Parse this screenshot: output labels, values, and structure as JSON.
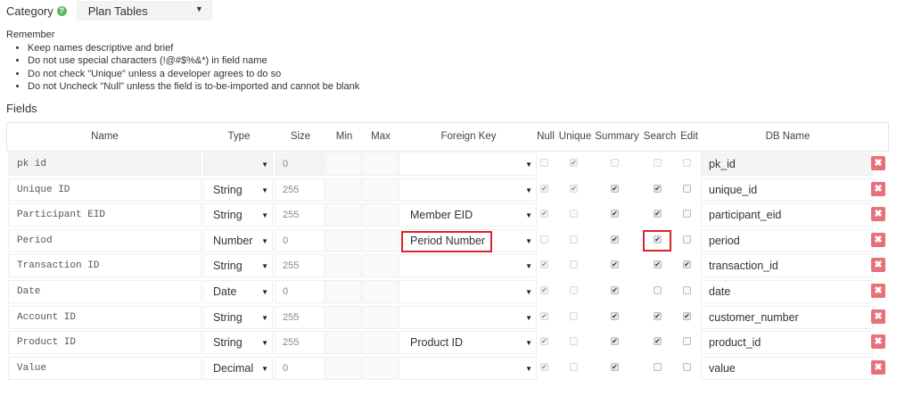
{
  "category": {
    "label": "Category",
    "help_icon": "question-icon",
    "selected": "Plan Tables"
  },
  "remember": {
    "title": "Remember",
    "items": [
      "Keep names descriptive and brief",
      "Do not use special characters (!@#$%&*) in field name",
      "Do not check \"Unique\" unless a developer agrees to do so",
      "Do not Uncheck \"Null\" unless the field is to-be-imported and cannot be blank"
    ]
  },
  "fields_title": "Fields",
  "columns": {
    "name": "Name",
    "type": "Type",
    "size": "Size",
    "min": "Min",
    "max": "Max",
    "fk": "Foreign Key",
    "null": "Null",
    "unique": "Unique",
    "summary": "Summary",
    "search": "Search",
    "edit": "Edit",
    "db": "DB Name"
  },
  "rows": [
    {
      "name": "pk id",
      "type": "",
      "size": "0",
      "fk": "",
      "null": false,
      "unique": true,
      "summary": false,
      "search": false,
      "edit": false,
      "db": "pk_id",
      "grey": true
    },
    {
      "name": "Unique ID",
      "type": "String",
      "size": "255",
      "fk": "",
      "null": true,
      "unique": true,
      "summary": true,
      "search": true,
      "edit": false,
      "db": "unique_id"
    },
    {
      "name": "Participant EID",
      "type": "String",
      "size": "255",
      "fk": "Member EID",
      "null": true,
      "unique": false,
      "summary": true,
      "search": true,
      "edit": false,
      "db": "participant_eid"
    },
    {
      "name": "Period",
      "type": "Number",
      "size": "0",
      "fk": "Period Number",
      "null": false,
      "unique": false,
      "summary": true,
      "search": true,
      "edit": false,
      "db": "period",
      "highlight": true
    },
    {
      "name": "Transaction ID",
      "type": "String",
      "size": "255",
      "fk": "",
      "null": true,
      "unique": false,
      "summary": true,
      "search": true,
      "edit": true,
      "db": "transaction_id"
    },
    {
      "name": "Date",
      "type": "Date",
      "size": "0",
      "fk": "",
      "null": true,
      "unique": false,
      "summary": true,
      "search": false,
      "edit": false,
      "db": "date"
    },
    {
      "name": "Account ID",
      "type": "String",
      "size": "255",
      "fk": "",
      "null": true,
      "unique": false,
      "summary": true,
      "search": true,
      "edit": true,
      "db": "customer_number"
    },
    {
      "name": "Product ID",
      "type": "String",
      "size": "255",
      "fk": "Product ID",
      "null": true,
      "unique": false,
      "summary": true,
      "search": true,
      "edit": false,
      "db": "product_id"
    },
    {
      "name": "Value",
      "type": "Decimal",
      "size": "0",
      "fk": "",
      "null": true,
      "unique": false,
      "summary": true,
      "search": false,
      "edit": false,
      "db": "value"
    }
  ],
  "delete_icon": "close-icon",
  "check_glyph": "✔",
  "caret_glyph": "▼",
  "colors": {
    "accent_red": "#d9232d",
    "delete_bg": "#e8707a",
    "help_green": "#5cb85c"
  }
}
